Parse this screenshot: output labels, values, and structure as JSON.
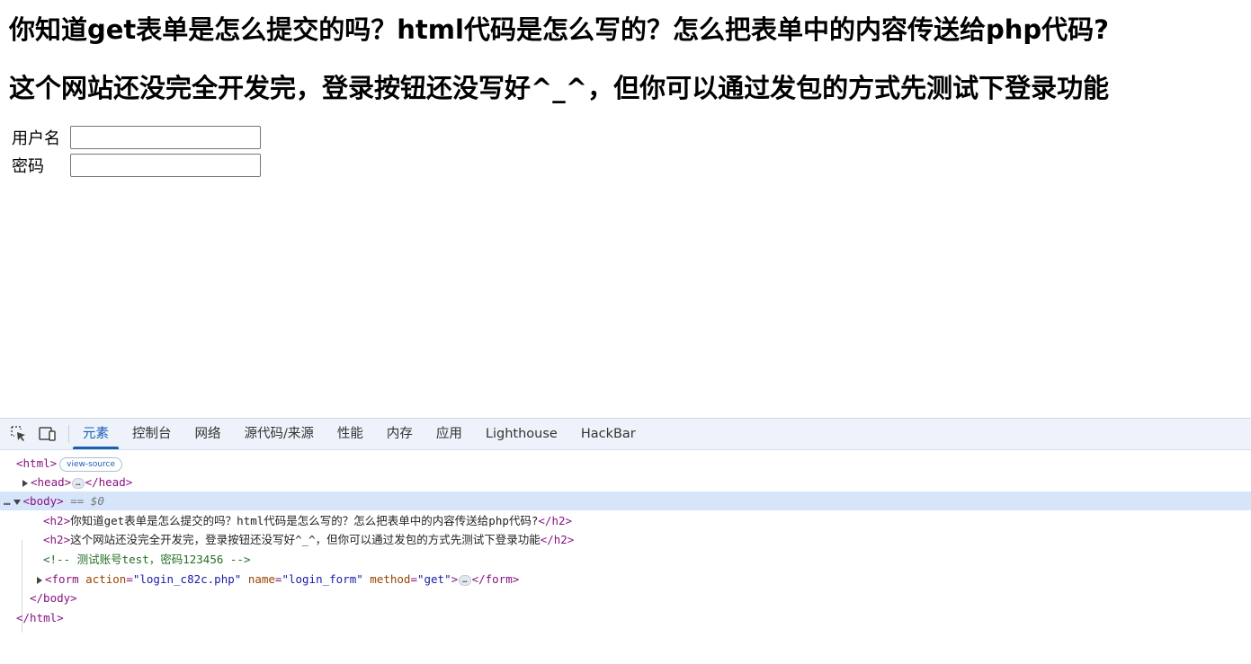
{
  "page": {
    "heading1": "你知道get表单是怎么提交的吗？html代码是怎么写的？怎么把表单中的内容传送给php代码?",
    "heading2": "这个网站还没完全开发完，登录按钮还没写好^_^，但你可以通过发包的方式先测试下登录功能",
    "form": {
      "username_label": "用户名",
      "username_value": "",
      "password_label": "密码",
      "password_value": ""
    }
  },
  "devtools": {
    "toolbar_icons": [
      "inspect-element-icon",
      "device-toolbar-icon"
    ],
    "tabs": [
      {
        "label": "元素",
        "active": true
      },
      {
        "label": "控制台",
        "active": false
      },
      {
        "label": "网络",
        "active": false
      },
      {
        "label": "源代码/来源",
        "active": false
      },
      {
        "label": "性能",
        "active": false
      },
      {
        "label": "内存",
        "active": false
      },
      {
        "label": "应用",
        "active": false
      },
      {
        "label": "Lighthouse",
        "active": false
      },
      {
        "label": "HackBar",
        "active": false
      }
    ],
    "accent_color": "#1a5fb4",
    "tree": {
      "html_open": "<html>",
      "view_source": "view-source",
      "head_open": "<head>",
      "head_ellipsis": "…",
      "head_close": "</head>",
      "body_dots": "…",
      "body_open": "<body>",
      "body_ref": "== $0",
      "h2_1_open": "<h2>",
      "h2_1_text": "你知道get表单是怎么提交的吗？html代码是怎么写的？怎么把表单中的内容传送给php代码?",
      "h2_1_close": "</h2>",
      "h2_2_open": "<h2>",
      "h2_2_text": "这个网站还没完全开发完，登录按钮还没写好^_^，但你可以通过发包的方式先测试下登录功能",
      "h2_2_close": "</h2>",
      "comment": "<!-- 测试账号test，密码123456 -->",
      "form_tag_open": "<form",
      "form_action_name": "action",
      "form_action_value": "\"login_c82c.php\"",
      "form_name_name": "name",
      "form_name_value": "\"login_form\"",
      "form_method_name": "method",
      "form_method_value": "\"get\"",
      "form_tag_end": ">",
      "form_ellipsis": "…",
      "form_close": "</form>",
      "body_close": "</body>",
      "html_close": "</html>"
    }
  }
}
